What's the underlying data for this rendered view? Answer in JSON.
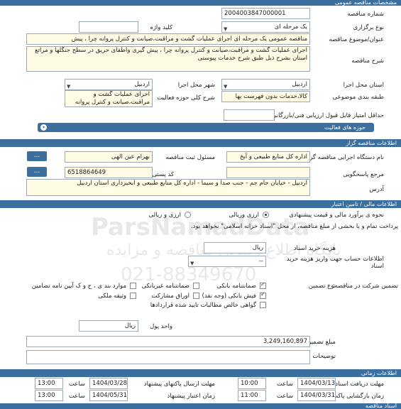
{
  "sections": {
    "general": "مشخصات مناقصه عمومی",
    "organizer": "اطلاعات مناقصه گزار",
    "financial": "اطلاعات مالی / تامین اعتبار",
    "schedule": "اطلاعات زمانی",
    "docs": "اسناد مناقصه"
  },
  "general": {
    "tender_no_label": "شماره مناقصه",
    "tender_no": "2004003847000001",
    "stage_label": "نوع برگزاری",
    "stage_value": "یک مرحله ای",
    "keyword_label": "کلید واژه",
    "title_label": "عنوان/موضوع مناقصه",
    "title_value": "مناقصه عمومی یک مرحله ای اجرای عملیات گشت و مراقبت،صیانت و کنترل پروانه چرا ، پیش",
    "desc_label": "شرح مناقصه",
    "desc_value": "اجرای عملیات گشت و مراقبت،صیانت و کنترل پروانه چرا ، پیش گیری واطفای حریق در سطح جنگلها و مراتع استان بشرح ذیل طبق شرح خدمات پیوستی",
    "province_label": "استان محل اجرا",
    "province_value": "اردبیل",
    "city_label": "شهر محل اجرا",
    "city_value": "اردبیل",
    "category_label": "طبقه بندی موضوعی",
    "category_value": "کالا،خدمات بدون فهرست بها",
    "scope_label": "شرح کلی حوزه فعالیت",
    "scope_value": "اجرای عملیات گشت و مراقبت،صیانت و کنترل پروانه",
    "min_score_label": "حداقل امتیاز قابل قبول ارزیابی فنی/بازرگانی",
    "activity_bar": "حوزه های فعالیت",
    "activity_toggle": "▾"
  },
  "organizer": {
    "org_label": "نام دستگاه اجرایی مناقصه گزار",
    "org_value": "اداره کل منابع طبیعی و آبخ",
    "dots": "...",
    "responsible_label": "مسئول ثبت مناقصه",
    "responsible_value": "بهرام عین الهی",
    "ref_label": "مرجع پاسخگویی",
    "postal_label": "کد پستی",
    "postal_value": "6518864649",
    "address_label": "آدرس",
    "address_value": "اردبیل - خیابان جام جم - جنب صدا و سیما - اداره کل منابع طبیعی و آبخیزداری استان اردبیل"
  },
  "financial": {
    "estimate_label": "نحوه ی برآورد مالی و قیمت پیشنهادی",
    "opt_rial": "ارزی وریالی",
    "opt_rial_only": "ارزی و ریالی",
    "payment_note": "پرداخت تمام و یا بخشی از مبلغ مناقصه، از محل \"اسناد خزانه اسلامی\" نخواهد بود.",
    "doc_price_label": "هزینه خرید اسناد",
    "doc_price_unit": "ریال",
    "account_label": "اطلاعات حساب جهت واریز هزینه خرید اسناد",
    "account_value": "--",
    "guarantee_label": "تضمین شرکت در مناقصه:",
    "guarantee_type_label": "نوع تضمین",
    "g_bank": "ضمانتنامه بانکی",
    "g_nonbank": "ضمانتنامه غیربانکی",
    "g_clauses": "موارد بند ی ، ح و ک آیین نامه تضامین",
    "g_check": "فیش بانکی (وجه نقد)",
    "g_bonds": "اوراق مشارکت",
    "g_property": "وثیقه ملکی",
    "g_receivables": "گواهی خالص مطالبات تایید شده قراردادها",
    "unit_label": "واحد پول",
    "unit_value": "ریال",
    "amount_label": "مبلغ تضمین",
    "amount_value": "3,249,160,897",
    "notes_label": "توضیحات"
  },
  "schedule": {
    "receive_doc_label": "مهلت دریافت اسناد",
    "receive_doc_date": "1404/03/13",
    "time_label": "ساعت",
    "receive_doc_time": "10:00",
    "send_offer_label": "مهلت ارسال پاکتهای پیشنهاد",
    "send_offer_date": "1404/03/28",
    "send_offer_time": "13:00",
    "open_label": "زمان بازگشایی پاکت ها",
    "open_date": "1404/03/31",
    "open_time": "11:00",
    "validity_label": "زمان اعتبار پیشنهاد",
    "validity_date": "1404/05/31",
    "validity_time": "13:00"
  },
  "watermark": {
    "brand": "ParsNamadData",
    "sub": "پایگاه اطلاع رسانی مناقصه و مزایده",
    "phone": "021-88349670"
  }
}
